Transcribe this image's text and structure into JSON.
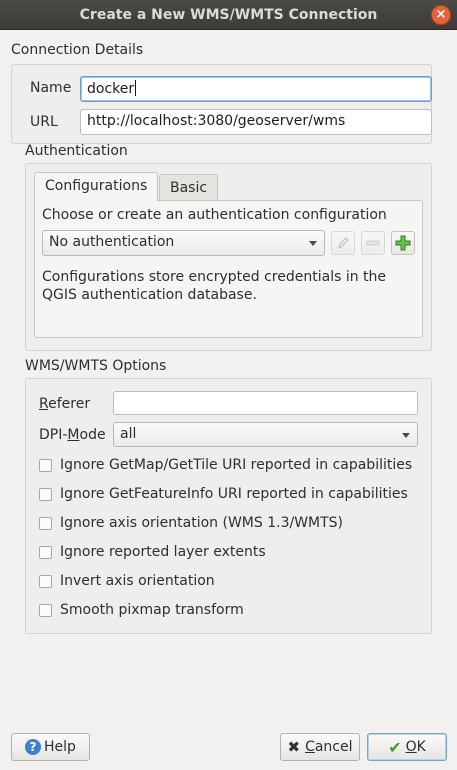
{
  "window": {
    "title": "Create a New WMS/WMTS Connection",
    "close_glyph": "×"
  },
  "connection": {
    "section_title": "Connection Details",
    "name_label": "Name",
    "name_value": "docker",
    "url_label": "URL",
    "url_value": "http://localhost:3080/geoserver/wms"
  },
  "auth": {
    "section_title": "Authentication",
    "tabs": [
      {
        "label": "Configurations",
        "active": true
      },
      {
        "label": "Basic",
        "active": false
      }
    ],
    "choose_text": "Choose or create an authentication configuration",
    "selected": "No authentication",
    "info_text": "Configurations store encrypted credentials in the QGIS authentication database.",
    "icons": [
      "edit-icon",
      "remove-icon",
      "add-icon"
    ],
    "accent_color": "#3a9a3a"
  },
  "options": {
    "section_title": "WMS/WMTS Options",
    "referer_label_prefix": "",
    "referer_label_underlined": "R",
    "referer_label_rest": "eferer",
    "referer_value": "",
    "dpi_label_prefix": "DPI-",
    "dpi_label_underlined": "M",
    "dpi_label_rest": "ode",
    "dpi_value": "all",
    "checkboxes": [
      {
        "label": "Ignore GetMap/GetTile URI reported in capabilities",
        "checked": false
      },
      {
        "label": "Ignore GetFeatureInfo URI reported in capabilities",
        "checked": false
      },
      {
        "label": "Ignore axis orientation (WMS 1.3/WMTS)",
        "checked": false
      },
      {
        "label": "Ignore reported layer extents",
        "checked": false
      },
      {
        "label": "Invert axis orientation",
        "checked": false
      },
      {
        "label": "Smooth pixmap transform",
        "checked": false
      }
    ]
  },
  "buttons": {
    "help_label": "Help",
    "help_icon": "?",
    "cancel_prefix": "",
    "cancel_underlined": "C",
    "cancel_rest": "ancel",
    "cancel_icon": "✖",
    "ok_prefix": "",
    "ok_underlined": "O",
    "ok_rest": "K",
    "ok_icon": "✔"
  }
}
